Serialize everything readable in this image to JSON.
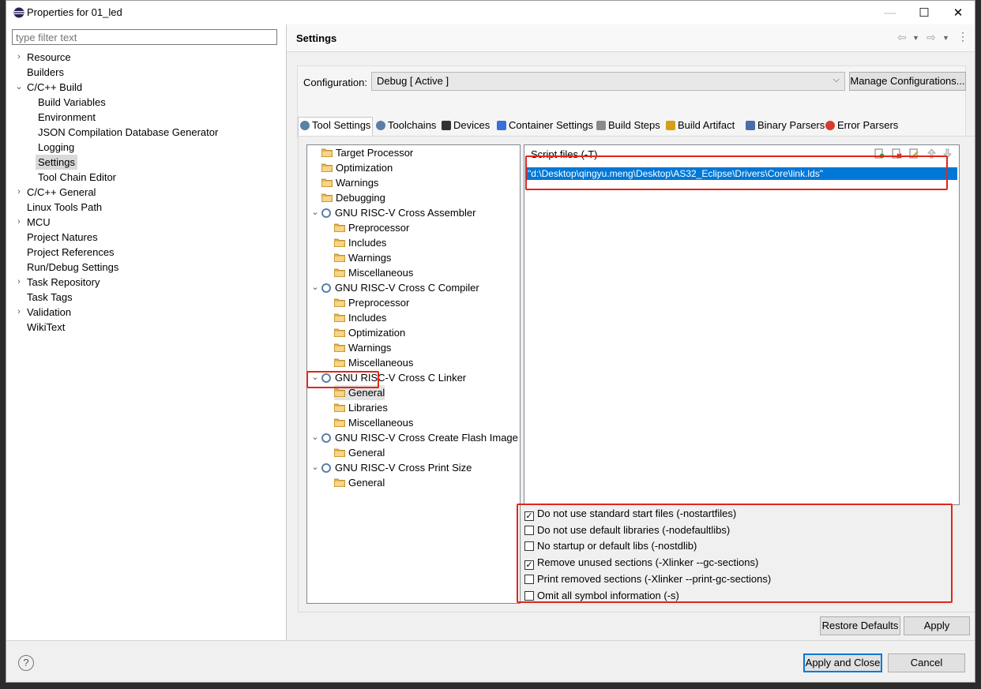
{
  "window": {
    "title": "Properties for 01_led",
    "minimize_glyph": "—",
    "maximize_glyph": "☐",
    "close_glyph": "✕"
  },
  "filter": {
    "placeholder": "type filter text"
  },
  "nav": [
    {
      "label": "Resource",
      "chevron": "›",
      "indent": 0
    },
    {
      "label": "Builders",
      "chevron": "",
      "indent": 0
    },
    {
      "label": "C/C++ Build",
      "chevron": "⌄",
      "indent": 0
    },
    {
      "label": "Build Variables",
      "chevron": "",
      "indent": 1
    },
    {
      "label": "Environment",
      "chevron": "",
      "indent": 1
    },
    {
      "label": "JSON Compilation Database Generator",
      "chevron": "",
      "indent": 1
    },
    {
      "label": "Logging",
      "chevron": "",
      "indent": 1
    },
    {
      "label": "Settings",
      "chevron": "",
      "indent": 1,
      "selected": true
    },
    {
      "label": "Tool Chain Editor",
      "chevron": "",
      "indent": 1
    },
    {
      "label": "C/C++ General",
      "chevron": "›",
      "indent": 0
    },
    {
      "label": "Linux Tools Path",
      "chevron": "",
      "indent": 0
    },
    {
      "label": "MCU",
      "chevron": "›",
      "indent": 0
    },
    {
      "label": "Project Natures",
      "chevron": "",
      "indent": 0
    },
    {
      "label": "Project References",
      "chevron": "",
      "indent": 0
    },
    {
      "label": "Run/Debug Settings",
      "chevron": "",
      "indent": 0
    },
    {
      "label": "Task Repository",
      "chevron": "›",
      "indent": 0
    },
    {
      "label": "Task Tags",
      "chevron": "",
      "indent": 0
    },
    {
      "label": "Validation",
      "chevron": "›",
      "indent": 0
    },
    {
      "label": "WikiText",
      "chevron": "",
      "indent": 0
    }
  ],
  "settings": {
    "title": "Settings"
  },
  "config": {
    "label": "Configuration:",
    "value": "Debug  [ Active ]",
    "manage_label": "Manage Configurations..."
  },
  "tabs": [
    {
      "label": "Tool Settings",
      "icon": "tool-settings-icon",
      "active": true
    },
    {
      "label": "Toolchains",
      "icon": "toolchains-icon"
    },
    {
      "label": "Devices",
      "icon": "devices-icon"
    },
    {
      "label": "Container Settings",
      "icon": "container-icon"
    },
    {
      "label": "Build Steps",
      "icon": "build-steps-icon"
    },
    {
      "label": "Build Artifact",
      "icon": "build-artifact-icon"
    },
    {
      "label": "Binary Parsers",
      "icon": "binary-parsers-icon"
    },
    {
      "label": "Error Parsers",
      "icon": "error-parsers-icon"
    }
  ],
  "tool_tree": [
    {
      "label": "Target Processor",
      "kind": "folder",
      "level": 0
    },
    {
      "label": "Optimization",
      "kind": "folder",
      "level": 0
    },
    {
      "label": "Warnings",
      "kind": "folder",
      "level": 0
    },
    {
      "label": "Debugging",
      "kind": "folder",
      "level": 0
    },
    {
      "label": "GNU RISC-V Cross Assembler",
      "kind": "tool",
      "level": 0
    },
    {
      "label": "Preprocessor",
      "kind": "folder",
      "level": 1
    },
    {
      "label": "Includes",
      "kind": "folder",
      "level": 1
    },
    {
      "label": "Warnings",
      "kind": "folder",
      "level": 1
    },
    {
      "label": "Miscellaneous",
      "kind": "folder",
      "level": 1
    },
    {
      "label": "GNU RISC-V Cross C Compiler",
      "kind": "tool",
      "level": 0
    },
    {
      "label": "Preprocessor",
      "kind": "folder",
      "level": 1
    },
    {
      "label": "Includes",
      "kind": "folder",
      "level": 1
    },
    {
      "label": "Optimization",
      "kind": "folder",
      "level": 1
    },
    {
      "label": "Warnings",
      "kind": "folder",
      "level": 1
    },
    {
      "label": "Miscellaneous",
      "kind": "folder",
      "level": 1
    },
    {
      "label": "GNU RISC-V Cross C Linker",
      "kind": "tool",
      "level": 0
    },
    {
      "label": "General",
      "kind": "folder",
      "level": 1,
      "selected": true
    },
    {
      "label": "Libraries",
      "kind": "folder",
      "level": 1
    },
    {
      "label": "Miscellaneous",
      "kind": "folder",
      "level": 1
    },
    {
      "label": "GNU RISC-V Cross Create Flash Image",
      "kind": "tool",
      "level": 0
    },
    {
      "label": "General",
      "kind": "folder",
      "level": 1
    },
    {
      "label": "GNU RISC-V Cross Print Size",
      "kind": "tool",
      "level": 0
    },
    {
      "label": "General",
      "kind": "folder",
      "level": 1
    }
  ],
  "script_files": {
    "title": "Script files (-T)",
    "entries": [
      "\"d:\\Desktop\\qingyu.meng\\Desktop\\AS32_Eclipse\\Drivers\\Core\\link.lds\""
    ]
  },
  "options": [
    {
      "label": "Do not use standard start files (-nostartfiles)",
      "checked": true
    },
    {
      "label": "Do not use default libraries (-nodefaultlibs)",
      "checked": false
    },
    {
      "label": "No startup or default libs (-nostdlib)",
      "checked": false
    },
    {
      "label": "Remove unused sections (-Xlinker --gc-sections)",
      "checked": true
    },
    {
      "label": "Print removed sections (-Xlinker --print-gc-sections)",
      "checked": false
    },
    {
      "label": "Omit all symbol information (-s)",
      "checked": false
    }
  ],
  "buttons": {
    "restore_defaults": "Restore Defaults",
    "apply": "Apply",
    "apply_close": "Apply and Close",
    "cancel": "Cancel",
    "help_glyph": "?"
  },
  "colors": {
    "selection": "#0078d7",
    "highlight_box": "#e0261b",
    "folder": "#e8b64c"
  }
}
